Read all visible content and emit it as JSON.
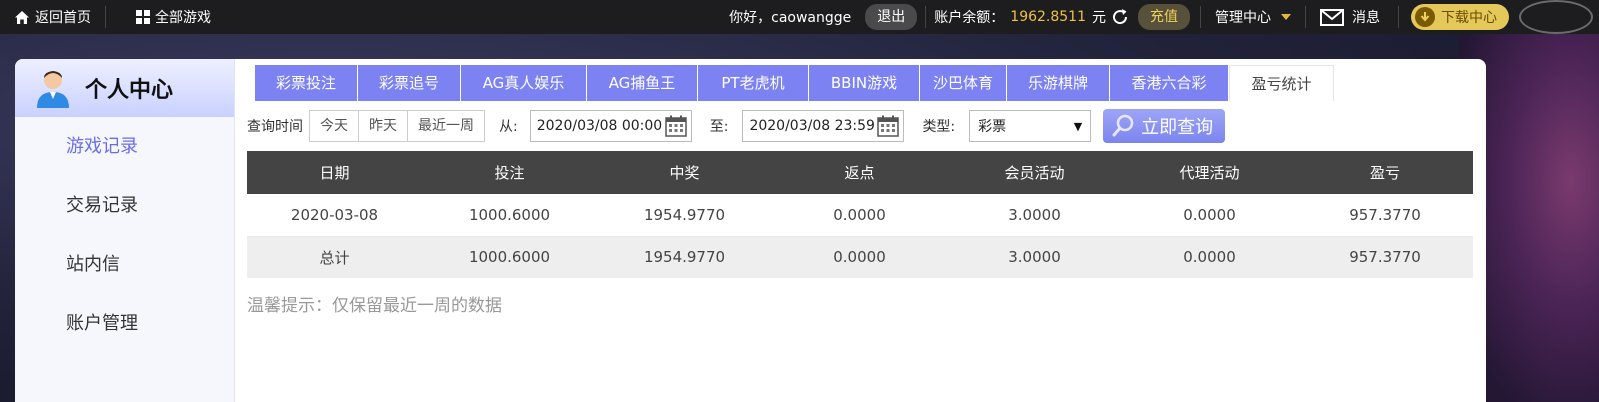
{
  "topbar": {
    "home_label": "返回首页",
    "all_games_label": "全部游戏",
    "greeting": "你好，caowangge",
    "logout_label": "退出",
    "balance_label": "账户余额：",
    "balance_value": "1962.8511",
    "balance_unit": "元",
    "recharge_label": "充值",
    "management_label": "管理中心",
    "messages_label": "消息",
    "download_label": "下载中心"
  },
  "sidebar": {
    "title": "个人中心",
    "items": [
      {
        "label": "游戏记录"
      },
      {
        "label": "交易记录"
      },
      {
        "label": "站内信"
      },
      {
        "label": "账户管理"
      }
    ]
  },
  "tabs": [
    {
      "label": "彩票投注"
    },
    {
      "label": "彩票追号"
    },
    {
      "label": "AG真人娱乐"
    },
    {
      "label": "AG捕鱼王"
    },
    {
      "label": "PT老虎机"
    },
    {
      "label": "BBIN游戏"
    },
    {
      "label": "沙巴体育"
    },
    {
      "label": "乐游棋牌"
    },
    {
      "label": "香港六合彩"
    },
    {
      "label": "盈亏统计"
    }
  ],
  "query": {
    "time_label": "查询时间",
    "quick_ranges": [
      "今天",
      "昨天",
      "最近一周"
    ],
    "from_label": "从:",
    "from_value": "2020/03/08 00:00",
    "to_label": "至:",
    "to_value": "2020/03/08 23:59",
    "type_label": "类型:",
    "type_value": "彩票",
    "submit_label": "立即查询"
  },
  "table": {
    "headers": [
      "日期",
      "投注",
      "中奖",
      "返点",
      "会员活动",
      "代理活动",
      "盈亏"
    ],
    "rows": [
      [
        "2020-03-08",
        "1000.6000",
        "1954.9770",
        "0.0000",
        "3.0000",
        "0.0000",
        "957.3770"
      ],
      [
        "总计",
        "1000.6000",
        "1954.9770",
        "0.0000",
        "3.0000",
        "0.0000",
        "957.3770"
      ]
    ]
  },
  "tip": "温馨提示：仅保留最近一周的数据",
  "colors": {
    "accent": "#7c82f2",
    "balance": "#f0c040",
    "table_header": "#444444"
  }
}
